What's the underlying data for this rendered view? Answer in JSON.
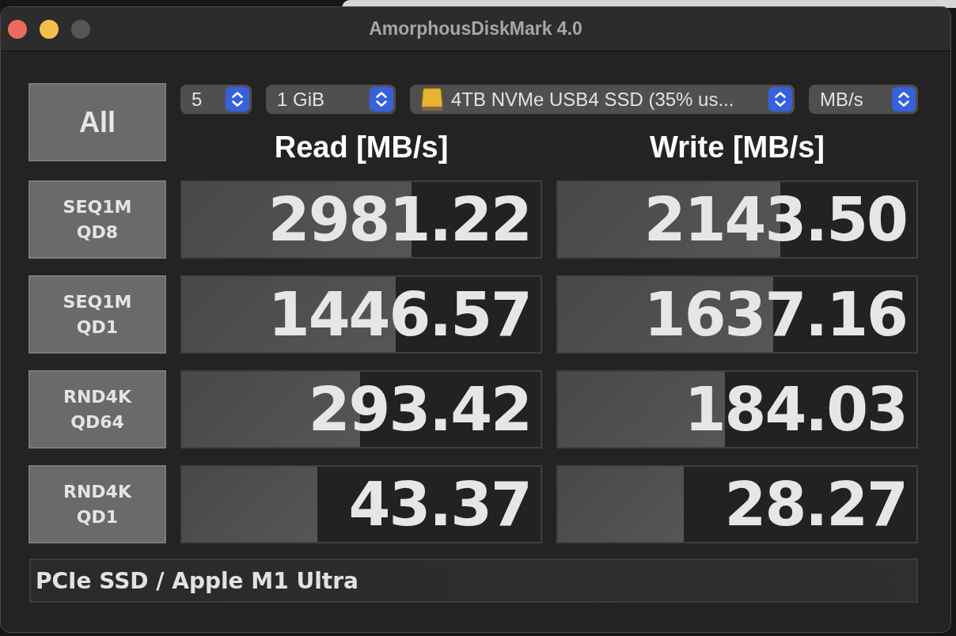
{
  "window": {
    "title": "AmorphousDiskMark 4.0",
    "zoom_disabled": true
  },
  "all_button": {
    "label": "All"
  },
  "selectors": [
    {
      "kind": "plain",
      "value": "5"
    },
    {
      "kind": "plain",
      "value": "1 GiB"
    },
    {
      "kind": "drive",
      "value": "4TB NVMe USB4 SSD (35% us..."
    },
    {
      "kind": "plain",
      "value": "MB/s"
    }
  ],
  "columns": [
    "Read [MB/s]",
    "Write [MB/s]"
  ],
  "tests": [
    {
      "test": "SEQ1M",
      "queue": "QD8",
      "read": {
        "value": "2981.22",
        "level": 0.64
      },
      "write": {
        "value": "2143.50",
        "level": 0.62
      }
    },
    {
      "test": "SEQ1M",
      "queue": "QD1",
      "read": {
        "value": "1446.57",
        "level": 0.595
      },
      "write": {
        "value": "1637.16",
        "level": 0.6
      }
    },
    {
      "test": "RND4K",
      "queue": "QD64",
      "read": {
        "value": "293.42",
        "level": 0.497
      },
      "write": {
        "value": "184.03",
        "level": 0.466
      }
    },
    {
      "test": "RND4K",
      "queue": "QD1",
      "read": {
        "value": "43.37",
        "level": 0.378
      },
      "write": {
        "value": "28.27",
        "level": 0.352
      }
    }
  ],
  "status": "PCIe SSD / Apple M1 Ultra"
}
